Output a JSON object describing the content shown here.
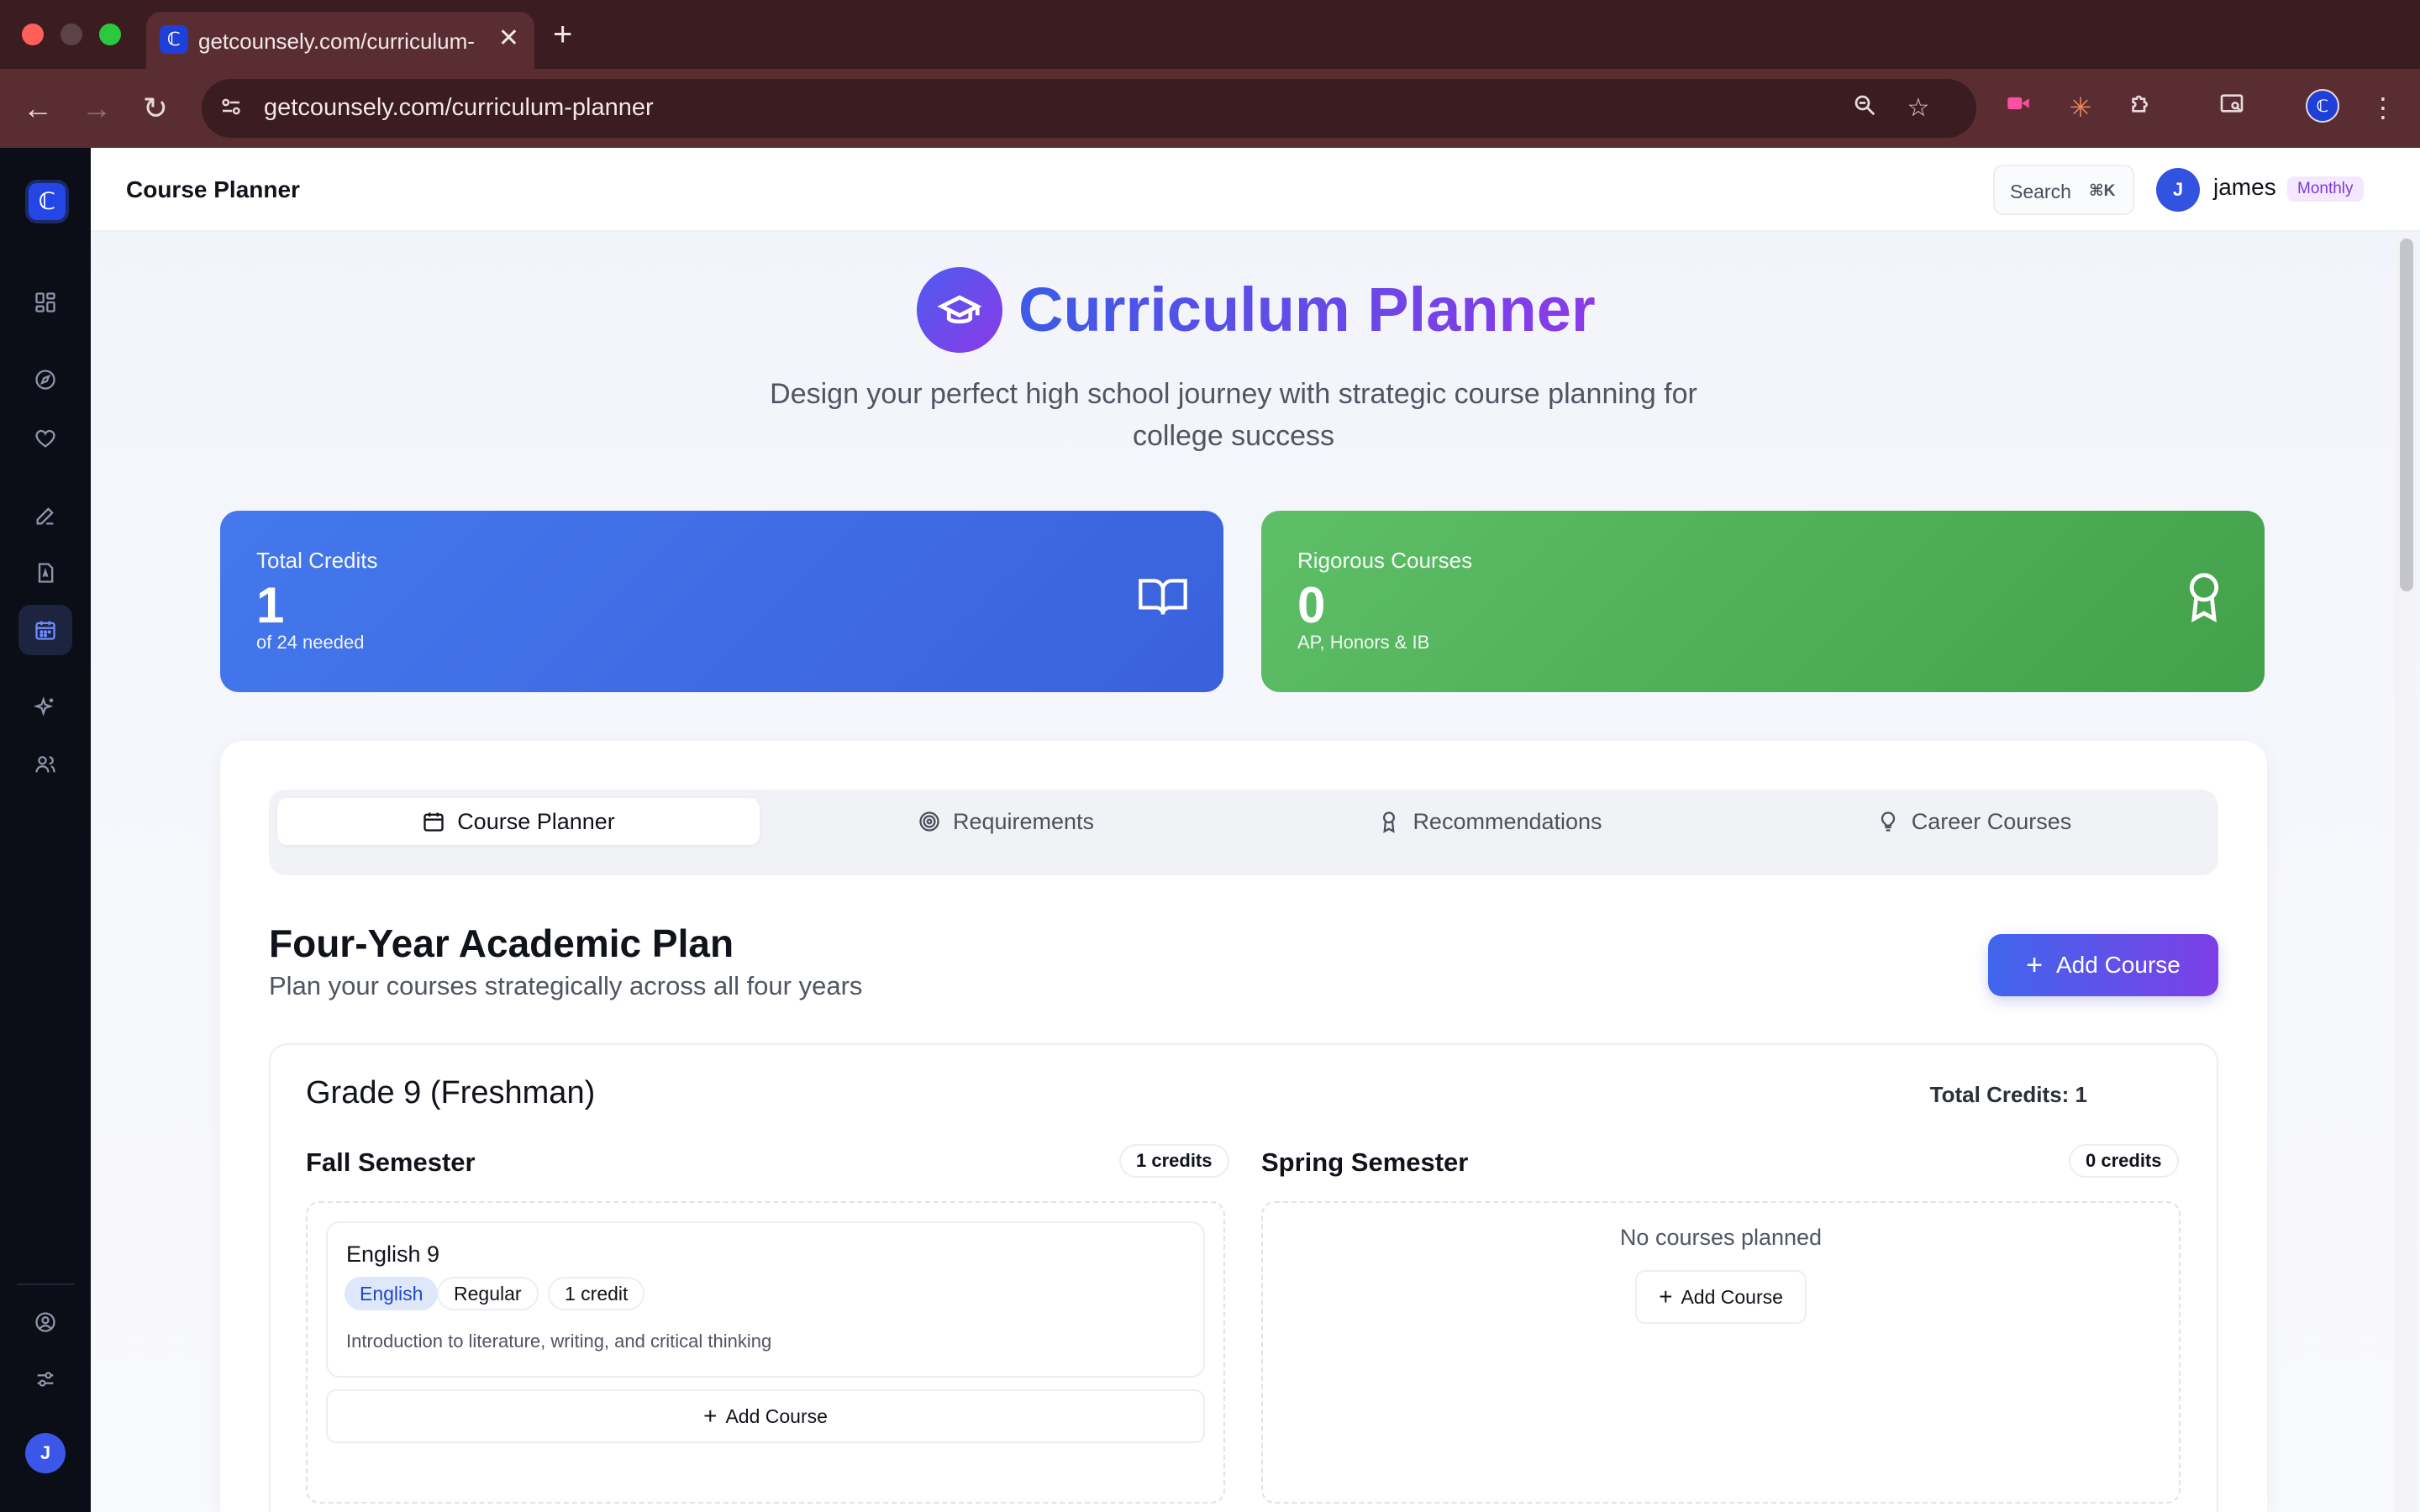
{
  "browser": {
    "tab_title": "getcounsely.com/curriculum-planner",
    "favicon_letter": "ℂ",
    "url": "getcounsely.com/curriculum-planner"
  },
  "app": {
    "logo_letter": "ℂ",
    "header": {
      "page_title": "Course Planner",
      "search_label": "Search",
      "search_shortcut": "⌘K",
      "user_initial": "J",
      "user_name": "james",
      "plan_badge": "Monthly"
    },
    "sidebar": {
      "items": [
        {
          "icon": "grid-icon",
          "active": false
        },
        {
          "icon": "compass-icon",
          "active": false
        },
        {
          "icon": "heart-icon",
          "active": false
        },
        {
          "icon": "pen-icon",
          "active": false
        },
        {
          "icon": "document-icon",
          "active": false
        },
        {
          "icon": "calendar-icon",
          "active": true
        },
        {
          "icon": "sparkles-icon",
          "active": false
        },
        {
          "icon": "users-icon",
          "active": false
        }
      ],
      "bottom_items": [
        {
          "icon": "user-circle-icon"
        },
        {
          "icon": "sliders-icon"
        }
      ],
      "avatar_initial": "J"
    },
    "hero": {
      "title": "Curriculum Planner",
      "subtitle": "Design your perfect high school journey with strategic course planning for college success"
    },
    "stats": [
      {
        "label": "Total Credits",
        "value": "1",
        "note": "of 24 needed",
        "color": "#3f6ce6"
      },
      {
        "label": "Rigorous Courses",
        "value": "0",
        "note": "AP, Honors & IB",
        "color": "#4fae58"
      }
    ],
    "tabs": [
      {
        "label": "Course Planner",
        "active": true
      },
      {
        "label": "Requirements",
        "active": false
      },
      {
        "label": "Recommendations",
        "active": false
      },
      {
        "label": "Career Courses",
        "active": false
      }
    ],
    "plan": {
      "title": "Four-Year Academic Plan",
      "subtitle": "Plan your courses strategically across all four years",
      "add_course_label": "Add Course"
    },
    "grade": {
      "title": "Grade 9 (Freshman)",
      "total_credits": "Total Credits: 1",
      "fall": {
        "title": "Fall Semester",
        "credits": "1 credits",
        "course": {
          "name": "English 9",
          "subject": "English",
          "level": "Regular",
          "credit": "1 credit",
          "description": "Introduction to literature, writing, and critical thinking"
        },
        "add_label": "Add Course"
      },
      "spring": {
        "title": "Spring Semester",
        "credits": "0 credits",
        "empty_text": "No courses planned",
        "add_label": "Add Course"
      }
    }
  }
}
